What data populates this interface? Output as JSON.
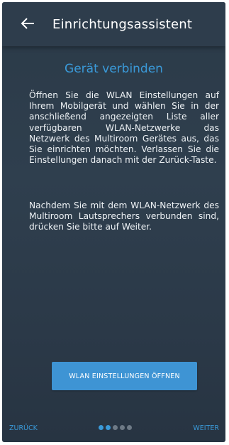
{
  "app_bar": {
    "back_icon": "arrow-left-icon",
    "title": "Einrichtungsassistent"
  },
  "content": {
    "heading": "Gerät verbinden",
    "paragraph_1": "Öffnen Sie die WLAN Einstellungen auf Ihrem Mobilgerät und wählen Sie in der anschließend angezeigten Liste aller verfügbaren WLAN-Netzwerke das Netzwerk des Multiroom Gerätes aus, das Sie einrichten möchten. Verlassen Sie die Einstellungen danach mit der Zurück-Taste.",
    "paragraph_2": "Nachdem Sie mit dem WLAN-Netzwerk des Multiroom Lautsprechers verbunden sind, drücken Sie bitte auf Weiter."
  },
  "action_button": {
    "label": "WLAN EINSTELLUNGEN ÖFFNEN"
  },
  "footer": {
    "back_label": "ZURÜCK",
    "next_label": "WEITER",
    "steps_total": 5,
    "steps_active": 2
  },
  "colors": {
    "accent": "#3a9ad9",
    "button": "#3e94d4",
    "background": "#2f3f4e",
    "inactive_dot": "#6e7a86"
  }
}
